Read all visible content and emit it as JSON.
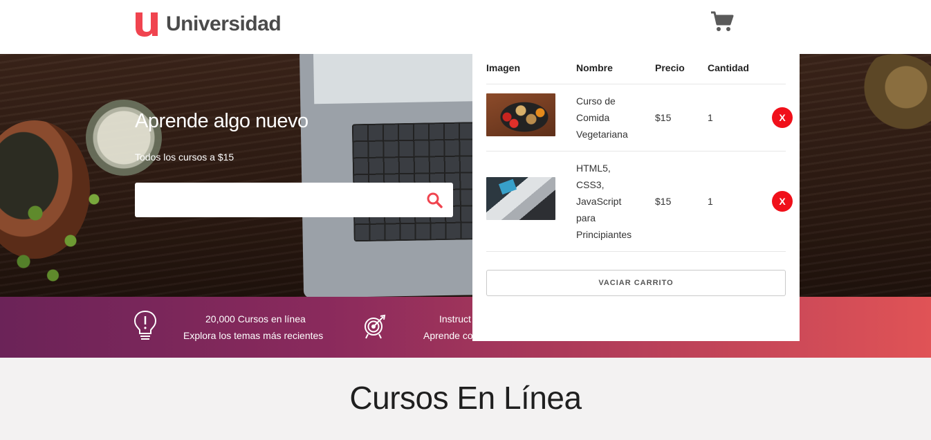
{
  "header": {
    "logo_text": "Universidad",
    "cart_icon": "shopping-cart-icon"
  },
  "hero": {
    "title": "Aprende algo nuevo",
    "subtitle": "Todos los cursos a $15",
    "search": {
      "value": "",
      "placeholder": ""
    },
    "search_icon": "search-icon"
  },
  "features": [
    {
      "icon": "lightbulb-icon",
      "line1": "20,000 Cursos en línea",
      "line2": "Explora los temas más recientes"
    },
    {
      "icon": "target-icon",
      "line1": "Instruct",
      "line2": "Aprende co"
    }
  ],
  "main": {
    "title": "Cursos En Línea"
  },
  "cart": {
    "columns": [
      "Imagen",
      "Nombre",
      "Precio",
      "Cantidad"
    ],
    "items": [
      {
        "image": "vegetarian-food-thumbnail",
        "name_lines": [
          "Curso de",
          "Comida",
          "Vegetariana"
        ],
        "price": "$15",
        "quantity": "1",
        "remove_label": "X"
      },
      {
        "image": "laptop-desk-thumbnail",
        "name_lines": [
          "HTML5,",
          "CSS3,",
          "JavaScript",
          "para",
          "Principiantes"
        ],
        "price": "$15",
        "quantity": "1",
        "remove_label": "X"
      }
    ],
    "empty_button": "VACIAR CARRITO"
  },
  "colors": {
    "brand_red": "#f0444f",
    "remove_red": "#f0101a",
    "features_gradient_start": "#6b2358",
    "features_gradient_end": "#e05356"
  }
}
